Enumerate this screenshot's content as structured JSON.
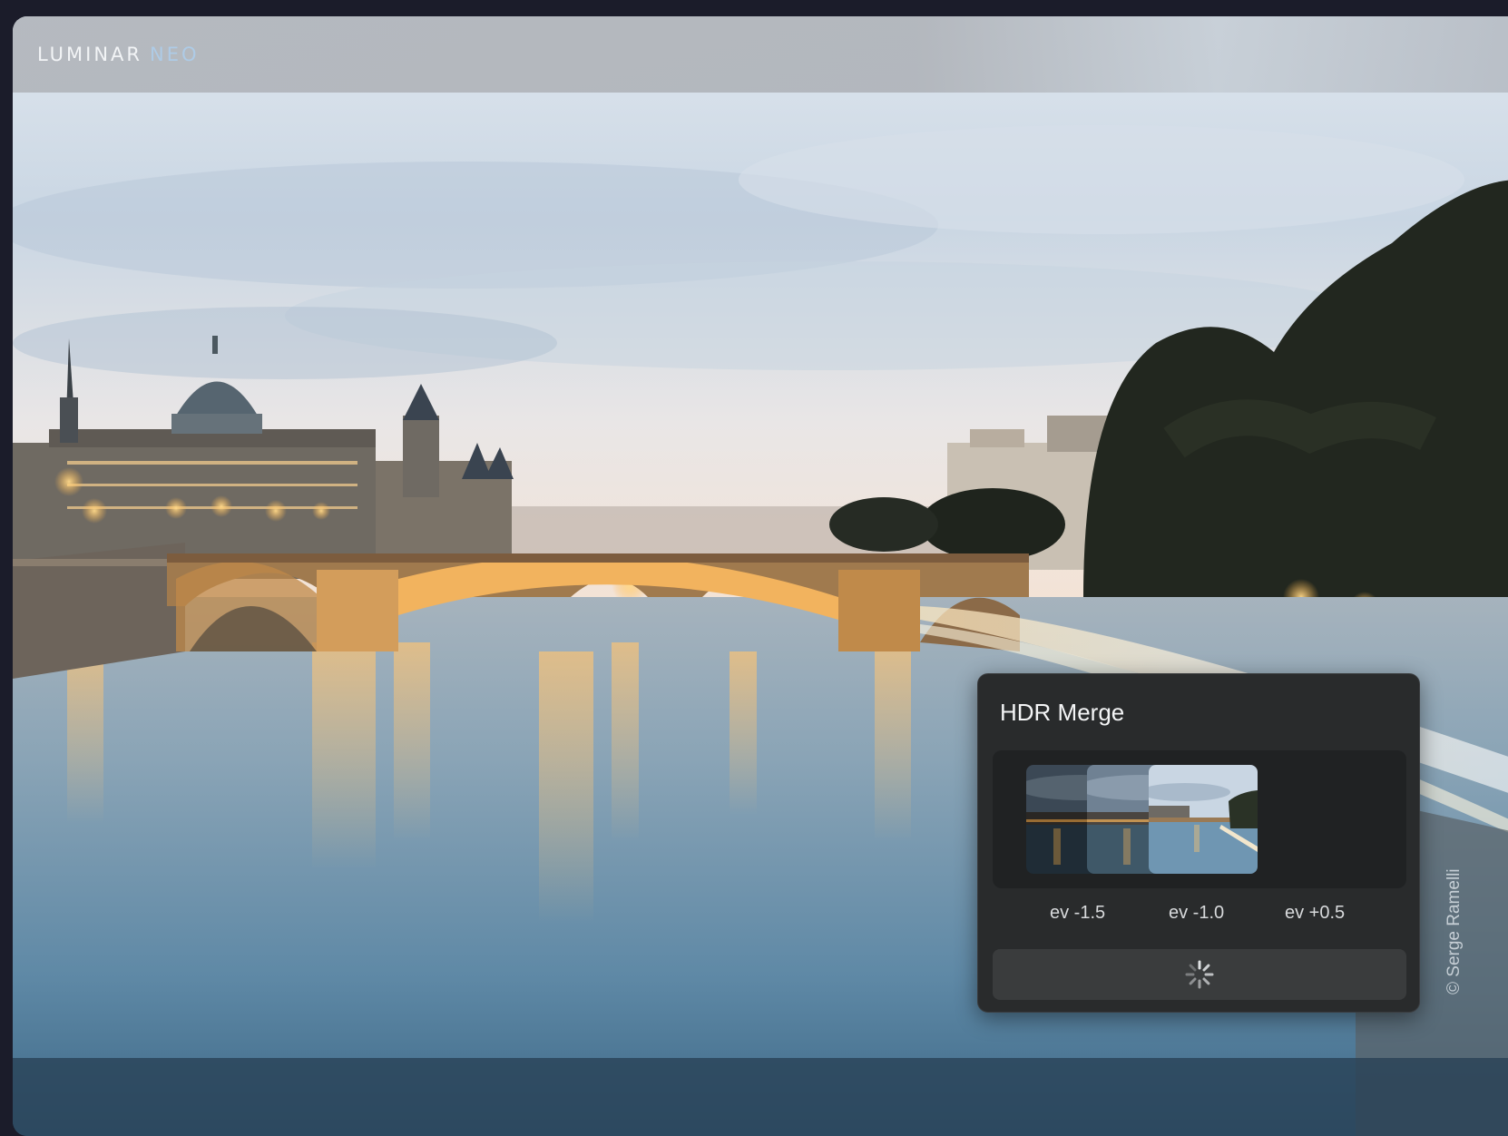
{
  "app": {
    "logo_part1": "LUMINAR",
    "logo_part2": "NEO"
  },
  "photo": {
    "credit": "© Serge Ramelli"
  },
  "hdr_merge": {
    "title": "HDR Merge",
    "brackets": [
      {
        "label": "ev -1.5"
      },
      {
        "label": "ev -1.0"
      },
      {
        "label": "ev +0.5"
      }
    ],
    "merge_button_state": "loading"
  },
  "colors": {
    "panel_bg": "#292b2c",
    "logo_accent": "#aecbe6",
    "window_bg": "#1b1c2a"
  },
  "icons": {
    "merge_button": "spinner-icon"
  }
}
